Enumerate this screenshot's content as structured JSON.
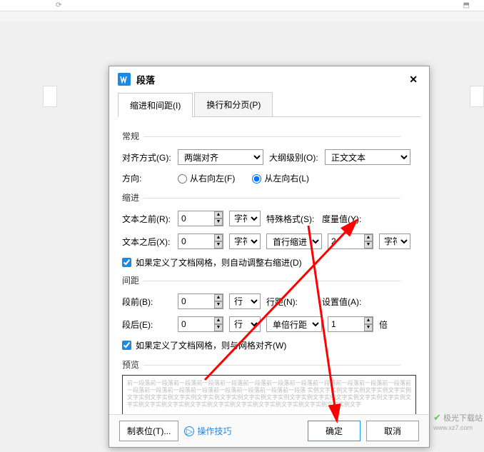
{
  "dialog": {
    "title": "段落",
    "tabs": [
      "缩进和间距(I)",
      "换行和分页(P)"
    ],
    "sections": {
      "general": {
        "title": "常规",
        "alignment_label": "对齐方式(G):",
        "alignment_value": "两端对齐",
        "outline_label": "大纲级别(O):",
        "outline_value": "正文文本",
        "direction_label": "方向:",
        "rtl_label": "从右向左(F)",
        "ltr_label": "从左向右(L)"
      },
      "indent": {
        "title": "缩进",
        "before_label": "文本之前(R):",
        "before_value": "0",
        "after_label": "文本之后(X):",
        "after_value": "0",
        "unit": "字符",
        "special_label": "特殊格式(S):",
        "special_value": "首行缩进",
        "measure_label": "度量值(Y):",
        "measure_value": "2",
        "measure_unit": "字符",
        "checkbox": "如果定义了文档网格，则自动调整右缩进(D)"
      },
      "spacing": {
        "title": "间距",
        "before_label": "段前(B):",
        "before_value": "0",
        "after_label": "段后(E):",
        "after_value": "0",
        "unit": "行",
        "line_label": "行距(N):",
        "line_value": "单倍行距",
        "set_label": "设置值(A):",
        "set_value": "1",
        "set_unit": "倍",
        "checkbox": "如果定义了文档网格，则与网格对齐(W)"
      },
      "preview": {
        "title": "预览",
        "text": "前一段落前一段落前一段落前一段落前一段落前一段落前一段落前一段落前一段落前一段落前一段落前一段落前一段落前一段落前一段落前一段落前一段落前一段落前一段落前一段落 实例文字实例文字实例文字实例文字实例文字实例文字实例文字实例文字实例文字实例文字实例文字实例文字实例文字实例文字实例文字实例文字实例文字实例文字实例文字实例文字实例文字实例文字实例文字实例文字实例文字实例文字实例文字"
      }
    },
    "footer": {
      "tabstops": "制表位(T)...",
      "tips": "操作技巧",
      "ok": "确定",
      "cancel": "取消"
    }
  },
  "watermark": {
    "name": "极光下载站",
    "url": "www.xz7.com"
  }
}
